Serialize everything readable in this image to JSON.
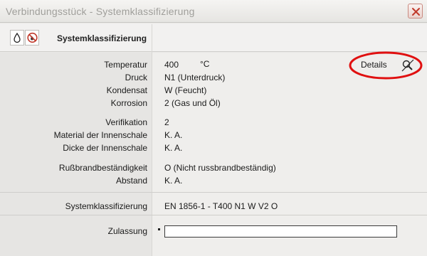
{
  "window": {
    "title": "Verbindungsstück - Systemklassifizierung",
    "close_icon": "close-icon"
  },
  "header": {
    "title": "Systemklassifizierung",
    "icons": [
      "droplet-icon",
      "no-fire-icon"
    ]
  },
  "fields": {
    "temperatur": {
      "label": "Temperatur",
      "value": "400",
      "unit": "°C"
    },
    "druck": {
      "label": "Druck",
      "value": "N1 (Unterdruck)"
    },
    "kondensat": {
      "label": "Kondensat",
      "value": "W (Feucht)"
    },
    "korrosion": {
      "label": "Korrosion",
      "value": "2 (Gas und Öl)"
    },
    "verifikation": {
      "label": "Verifikation",
      "value": "2"
    },
    "material": {
      "label": "Material der Innenschale",
      "value": "K. A."
    },
    "dicke": {
      "label": "Dicke der Innenschale",
      "value": "K. A."
    },
    "russbrand": {
      "label": "Rußbrandbeständigkeit",
      "value": "O (Nicht russbrandbeständig)"
    },
    "abstand": {
      "label": "Abstand",
      "value": "K. A."
    }
  },
  "details": {
    "label": "Details",
    "icon": "magnifier-crossed-icon"
  },
  "result": {
    "label": "Systemklassifizierung",
    "value": "EN 1856-1 - T400 N1 W V2 O"
  },
  "zulassung": {
    "label": "Zulassung",
    "value": ""
  },
  "colors": {
    "highlight": "#e01010",
    "close_x": "#c0392b"
  }
}
